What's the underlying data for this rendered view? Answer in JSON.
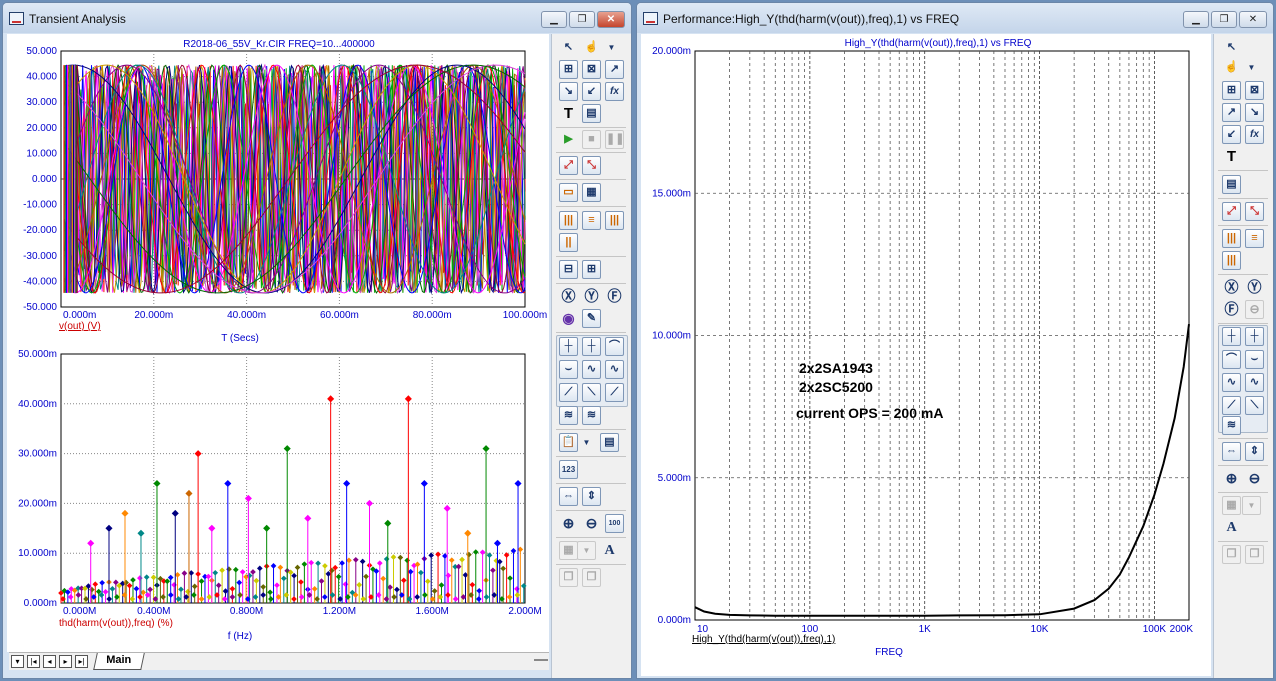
{
  "left_window": {
    "title": "Transient Analysis",
    "top_plot": {
      "title": "R2018-06_55V_Kr.CIR FREQ=10...400000",
      "ylabels": [
        "50.000",
        "40.000",
        "30.000",
        "20.000",
        "10.000",
        "0.000",
        "-10.000",
        "-20.000",
        "-30.000",
        "-40.000",
        "-50.000"
      ],
      "xlabels": [
        "0.000m",
        "20.000m",
        "40.000m",
        "60.000m",
        "80.000m",
        "100.000m"
      ],
      "trace_label": "v(out) (V)",
      "xaxis_title": "T (Secs)"
    },
    "bottom_plot": {
      "ylabels": [
        "50.000m",
        "40.000m",
        "30.000m",
        "20.000m",
        "10.000m",
        "0.000m"
      ],
      "xlabels": [
        "0.000M",
        "0.400M",
        "0.800M",
        "1.200M",
        "1.600M",
        "2.000M"
      ],
      "trace_label": "thd(harm(v(out)),freq) (%)",
      "xaxis_title": "f (Hz)"
    },
    "tab_label": "Main"
  },
  "right_window": {
    "title": "Performance:High_Y(thd(harm(v(out)),freq),1) vs FREQ",
    "plot_title": "High_Y(thd(harm(v(out)),freq),1) vs FREQ",
    "ylabels": [
      "20.000m",
      "15.000m",
      "10.000m",
      "5.000m",
      "0.000m"
    ],
    "xlabels": [
      "10",
      "100",
      "1K",
      "10K",
      "100K",
      "200K"
    ],
    "trace_label": "High_Y(thd(harm(v(out)),freq),1)",
    "xaxis_title": "FREQ",
    "annotations": [
      "2x2SA1943",
      "2x2SC5200",
      "current OPS = 200 mA"
    ]
  },
  "toolbar_icons": [
    "select-arrow",
    "hand-pointer",
    "zoom",
    "text-tool",
    "run",
    "stop",
    "pause",
    "cursor",
    "font-tool"
  ],
  "colors": {
    "window_frame": "#d6e3f2",
    "desktop": "#6d8fb8",
    "axis_label": "#0000cc",
    "trace_label": "#cc0000",
    "grid": "#7a7a7a"
  },
  "chart_data": {
    "type": "line",
    "title": "High_Y(thd(harm(v(out)),freq),1) vs FREQ",
    "xlabel": "FREQ",
    "ylabel": "",
    "xscale": "log",
    "xlim": [
      10,
      200000
    ],
    "ylim": [
      0,
      0.02
    ],
    "series": [
      {
        "name": "High_Y(thd(harm(v(out)),freq),1)",
        "x": [
          10,
          12,
          15,
          20,
          30,
          50,
          100,
          200,
          500,
          1000,
          2000,
          5000,
          10000,
          20000,
          30000,
          40000,
          50000,
          60000,
          80000,
          100000,
          120000,
          150000,
          180000,
          200000
        ],
        "y": [
          0.00045,
          0.0003,
          0.00022,
          0.00018,
          0.00016,
          0.00015,
          0.00015,
          0.00015,
          0.00015,
          0.00015,
          0.00016,
          0.00017,
          0.0002,
          0.0004,
          0.0007,
          0.0011,
          0.0016,
          0.0022,
          0.0033,
          0.0044,
          0.0055,
          0.0071,
          0.0089,
          0.0104
        ]
      }
    ]
  }
}
